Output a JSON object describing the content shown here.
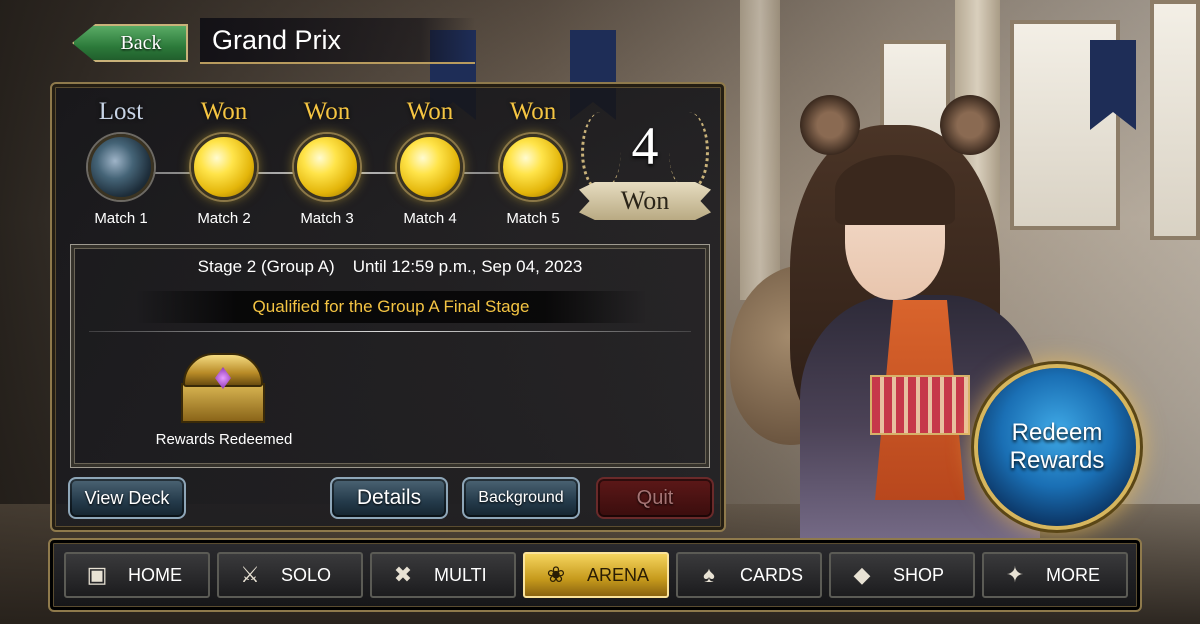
{
  "header": {
    "back_label": "Back",
    "title": "Grand Prix"
  },
  "matches": [
    {
      "result": "Lost",
      "label": "Match 1",
      "status": "lost"
    },
    {
      "result": "Won",
      "label": "Match 2",
      "status": "won"
    },
    {
      "result": "Won",
      "label": "Match 3",
      "status": "won"
    },
    {
      "result": "Won",
      "label": "Match 4",
      "status": "won"
    },
    {
      "result": "Won",
      "label": "Match 5",
      "status": "won"
    }
  ],
  "wins": {
    "count": "4",
    "label": "Won"
  },
  "stage": {
    "name": "Stage 2 (Group A)",
    "deadline": "Until 12:59 p.m., Sep 04, 2023",
    "qualified": "Qualified for the Group A Final Stage"
  },
  "rewards": {
    "chest_label": "Rewards Redeemed",
    "redeem_line1": "Redeem",
    "redeem_line2": "Rewards"
  },
  "actions": {
    "view_deck": "View Deck",
    "details": "Details",
    "background": "Background",
    "quit": "Quit"
  },
  "nav": [
    {
      "label": "HOME",
      "icon": "home-icon",
      "active": false
    },
    {
      "label": "SOLO",
      "icon": "sword-shield-icon",
      "active": false
    },
    {
      "label": "MULTI",
      "icon": "crossed-swords-icon",
      "active": false
    },
    {
      "label": "ARENA",
      "icon": "laurel-icon",
      "active": true
    },
    {
      "label": "CARDS",
      "icon": "cards-icon",
      "active": false
    },
    {
      "label": "SHOP",
      "icon": "crystal-icon",
      "active": false
    },
    {
      "label": "MORE",
      "icon": "sparkles-icon",
      "active": false
    }
  ],
  "colors": {
    "won": "#f5c542",
    "qualified": "#f4c443",
    "active_nav": "#e0b42c"
  }
}
